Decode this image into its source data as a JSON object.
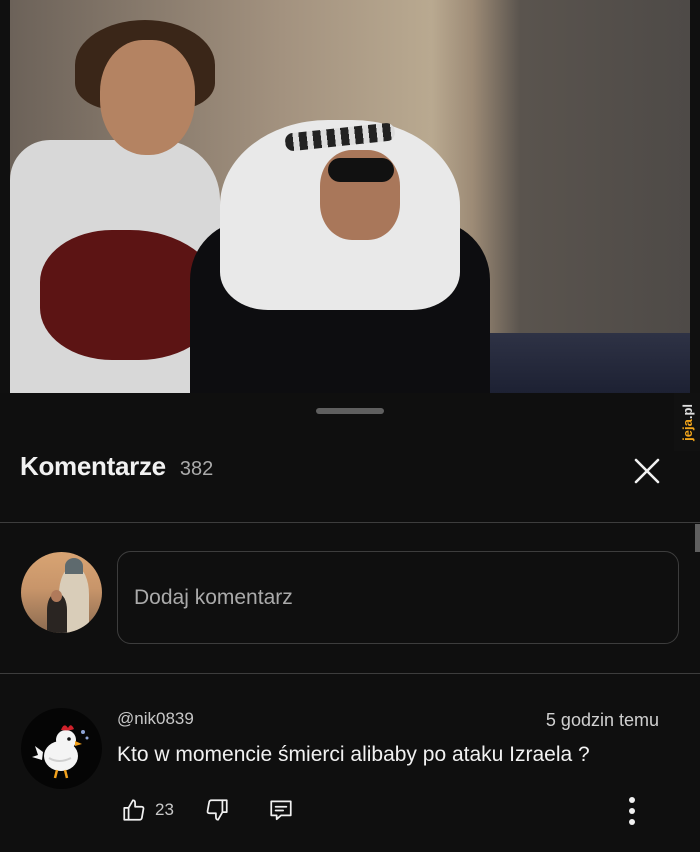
{
  "sheet": {
    "title": "Komentarze",
    "count": "382",
    "watermark": "jeja.pl"
  },
  "composer": {
    "placeholder": "Dodaj komentarz"
  },
  "comments": [
    {
      "user": "@nik0839",
      "time": "5 godzin temu",
      "text": "Kto w momencie śmierci alibaby po ataku Izraela ?",
      "likes": "23"
    }
  ],
  "icons": {
    "close": "close-icon",
    "like": "thumbs-up-icon",
    "dislike": "thumbs-down-icon",
    "reply": "reply-icon",
    "more": "more-vertical-icon"
  },
  "colors": {
    "background": "#0f0f0f",
    "text": "#f1f1f1",
    "secondary": "#aaaaaa",
    "border": "#3d3d3d"
  }
}
